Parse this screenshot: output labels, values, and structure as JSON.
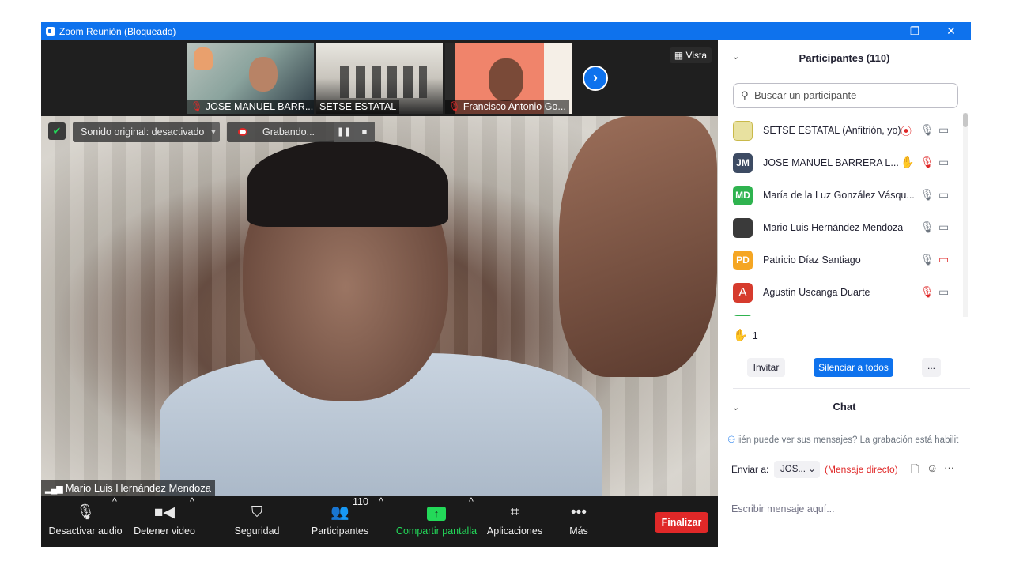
{
  "window": {
    "title": "Zoom Reunión (Bloqueado)",
    "minimize": "—",
    "restore": "❐",
    "close": "✕"
  },
  "strip": {
    "thumbs": [
      {
        "name": "JOSE MANUEL BARR...",
        "muted": true
      },
      {
        "name": "SETSE ESTATAL",
        "muted": false
      },
      {
        "name": "Francisco Antonio Go...",
        "muted": true
      }
    ],
    "view_label": "Vista",
    "next_label": "›"
  },
  "main": {
    "sound_label": "Sonido original: desactivado",
    "recording_label": "Grabando...",
    "speaker_name": "Mario Luis Hernández Mendoza"
  },
  "toolbar": {
    "audio": "Desactivar audio",
    "video": "Detener video",
    "security": "Seguridad",
    "participants": "Participantes",
    "participants_count": "110",
    "share": "Compartir pantalla",
    "apps": "Aplicaciones",
    "more": "Más",
    "end": "Finalizar"
  },
  "panel": {
    "title": "Participantes (110)",
    "search_placeholder": "Buscar un participante",
    "participants": [
      {
        "initials": "",
        "name": "SETSE ESTATAL (Anfitrión, yo)",
        "color": "#e8e1a0"
      },
      {
        "initials": "JM",
        "name": "JOSE MANUEL BARRERA L...",
        "color": "#3d4b63"
      },
      {
        "initials": "MD",
        "name": "María de la Luz González Vásqu...",
        "color": "#2fb34f"
      },
      {
        "initials": "",
        "name": "Mario Luis Hernández Mendoza",
        "color": "#3a3a3a"
      },
      {
        "initials": "PD",
        "name": "Patricio Díaz Santiago",
        "color": "#f5a623"
      },
      {
        "initials": "A",
        "name": "Agustin Uscanga Duarte",
        "color": "#d63b2d"
      }
    ],
    "hands_count": "1",
    "invite": "Invitar",
    "mute_all": "Silenciar a todos",
    "more": "...",
    "chat_title": "Chat",
    "chat_notice": "iién puede ver sus mensajes? La grabación está habilit",
    "send_to_label": "Enviar a:",
    "send_to_value": "JOS...",
    "direct_label": "(Mensaje directo)",
    "input_placeholder": "Escribir mensaje aquí..."
  },
  "colors": {
    "zoom_blue": "#0e72ed",
    "end_red": "#e02828",
    "share_green": "#23d959"
  }
}
